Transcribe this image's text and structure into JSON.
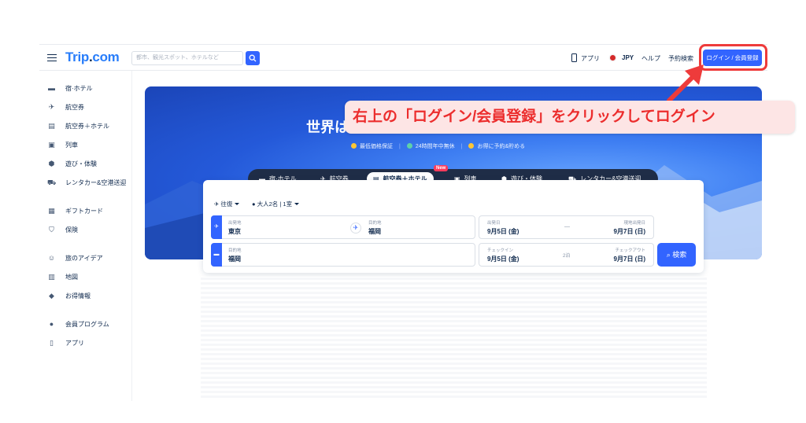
{
  "header": {
    "logo_text": "Trip",
    "logo_dot": ".",
    "logo_suffix": "com",
    "search_placeholder": "都市、観光スポット、ホテルなど",
    "app_label": "アプリ",
    "currency": "JPY",
    "help": "ヘルプ",
    "booking_search": "予約検索",
    "login_button": "ログイン / 会員登録"
  },
  "sidebar": {
    "items": [
      {
        "label": "宿·ホテル",
        "icon": "bed-icon"
      },
      {
        "label": "航空券",
        "icon": "plane-icon"
      },
      {
        "label": "航空券＋ホテル",
        "icon": "hotel-plane-icon"
      },
      {
        "label": "列車",
        "icon": "train-icon"
      },
      {
        "label": "遊び・体験",
        "icon": "activity-icon"
      },
      {
        "label": "レンタカー&空港送迎",
        "icon": "car-icon"
      },
      {
        "label": "ギフトカード",
        "icon": "giftcard-icon"
      },
      {
        "label": "保険",
        "icon": "shield-icon"
      },
      {
        "label": "旅のアイデア",
        "icon": "person-icon"
      },
      {
        "label": "地図",
        "icon": "map-icon"
      },
      {
        "label": "お得情報",
        "icon": "tag-icon"
      },
      {
        "label": "会員プログラム",
        "icon": "member-icon"
      },
      {
        "label": "アプリ",
        "icon": "phone-icon"
      }
    ]
  },
  "hero": {
    "title": "世界は",
    "badges": [
      "最低価格保証",
      "24時間年中無休",
      "お得に予約&貯める"
    ]
  },
  "callout": {
    "text": "右上の「ログイン/会員登録」をクリックしてログイン"
  },
  "tabs": {
    "items": [
      "宿·ホテル",
      "航空券",
      "航空券＋ホテル",
      "列車",
      "遊び・体験",
      "レンタカー&空港送迎"
    ],
    "active_index": 2,
    "new_badge": "New"
  },
  "booking": {
    "trip_type": "往復",
    "travelers": "大人2名",
    "rooms": "1室",
    "flight": {
      "origin_label": "出発地",
      "origin": "東京",
      "destination_label": "目的地",
      "destination": "福岡",
      "depart_label": "出発日",
      "depart": "9月5日 (金)",
      "return_label": "現地出発日",
      "return": "9月7日 (日)"
    },
    "hotel": {
      "destination_label": "目的地",
      "destination": "福岡",
      "checkin_label": "チェックイン",
      "checkin": "9月5日 (金)",
      "nights": "2泊",
      "checkout_label": "チェックアウト",
      "checkout": "9月7日 (日)"
    },
    "search_button": "検索"
  },
  "colors": {
    "accent": "#3264ff",
    "callout_text": "#ec2d2d",
    "callout_bg": "#fde5e5",
    "tab_bar": "#1f2d47"
  }
}
